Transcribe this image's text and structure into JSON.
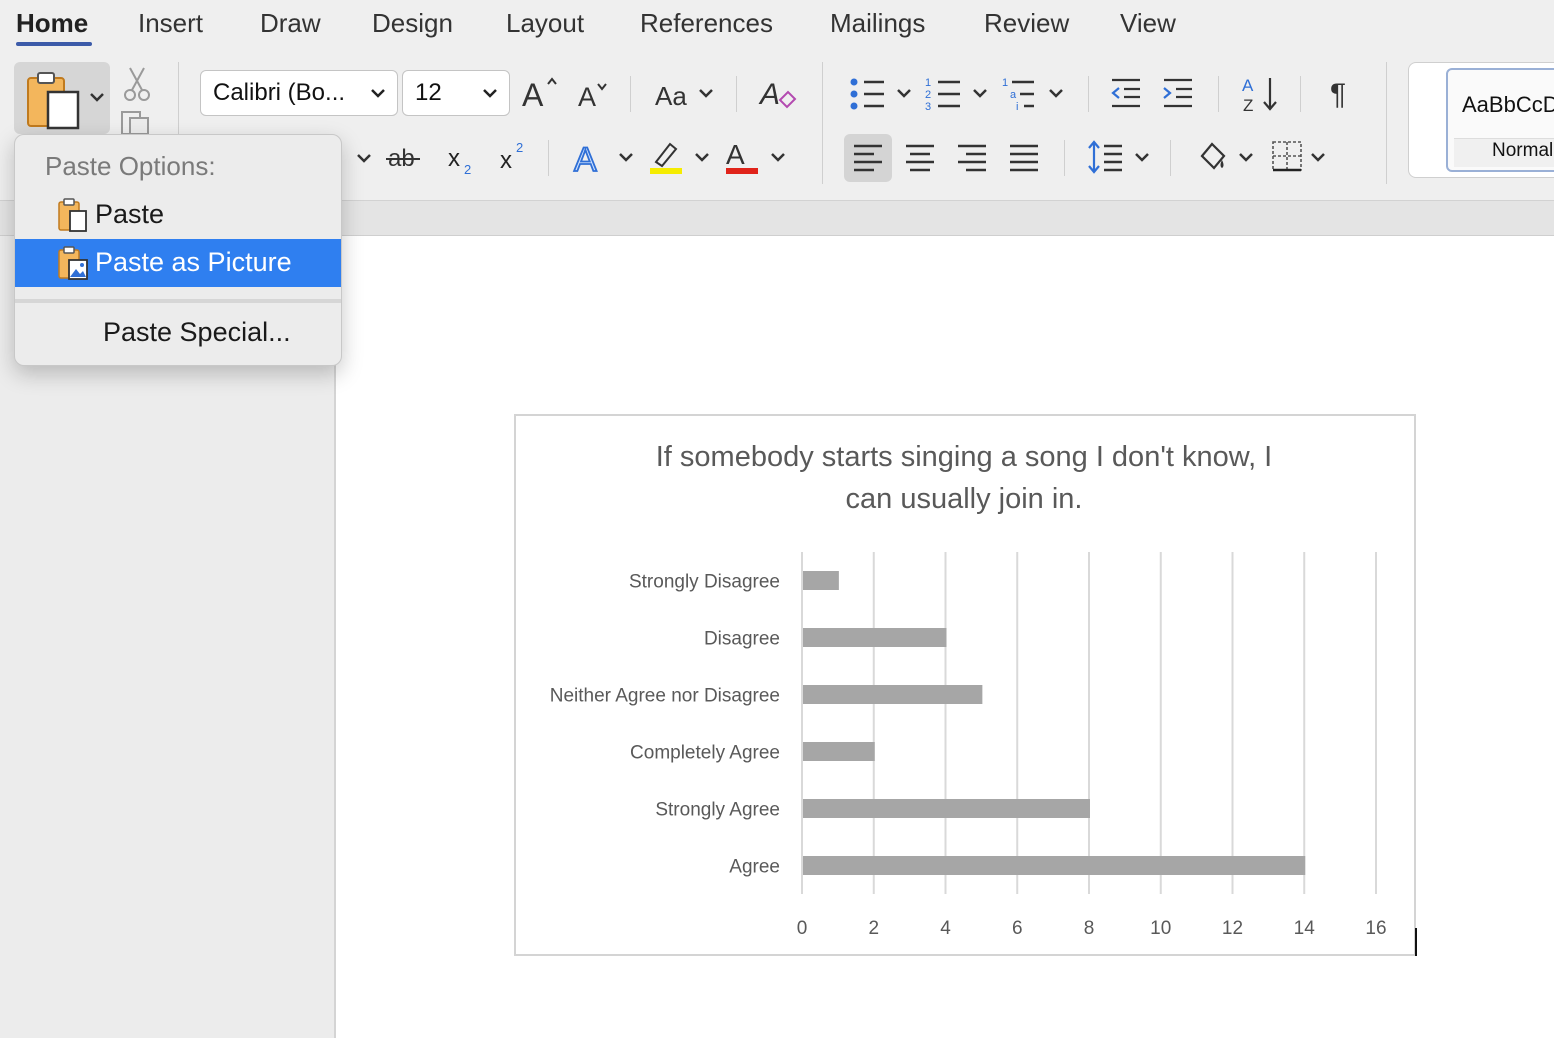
{
  "tabs": [
    {
      "label": "Home",
      "active": true
    },
    {
      "label": "Insert"
    },
    {
      "label": "Draw"
    },
    {
      "label": "Design"
    },
    {
      "label": "Layout"
    },
    {
      "label": "References"
    },
    {
      "label": "Mailings"
    },
    {
      "label": "Review"
    },
    {
      "label": "View"
    }
  ],
  "ribbon": {
    "font_name": "Calibri (Bo...",
    "font_size": "12",
    "styles": {
      "sample": "AaBbCcDd",
      "name": "Normal"
    },
    "highlight_color": "#f5ec00",
    "font_color": "#e0231a",
    "icons": [
      "paste-icon",
      "cut-icon",
      "copy-icon",
      "grow-font-icon",
      "shrink-font-icon",
      "change-case-icon",
      "clear-formatting-icon",
      "bullets-icon",
      "numbering-icon",
      "multilevel-list-icon",
      "decrease-indent-icon",
      "increase-indent-icon",
      "sort-icon",
      "pilcrow-icon",
      "strikethrough-icon",
      "subscript-icon",
      "superscript-icon",
      "text-effects-icon",
      "highlight-icon",
      "font-color-icon",
      "align-left-icon",
      "align-center-icon",
      "align-right-icon",
      "justify-icon",
      "line-spacing-icon",
      "shading-icon",
      "borders-icon"
    ]
  },
  "paste_menu": {
    "header": "Paste Options:",
    "items": [
      {
        "label": "Paste",
        "selected": false
      },
      {
        "label": "Paste as Picture",
        "selected": true
      }
    ],
    "special": "Paste Special..."
  },
  "chart_data": {
    "type": "bar",
    "orientation": "horizontal",
    "title": "If somebody starts singing a song I don't know, I can usually join in.",
    "title_lines": [
      "If somebody starts singing a song I don't know, I",
      "can usually join in."
    ],
    "categories": [
      "Strongly Disagree",
      "Disagree",
      "Neither Agree nor Disagree",
      "Completely Agree",
      "Strongly Agree",
      "Agree"
    ],
    "values": [
      1,
      4,
      5,
      2,
      8,
      14
    ],
    "xlim": [
      0,
      16
    ],
    "xticks": [
      "0",
      "2",
      "4",
      "6",
      "8",
      "10",
      "12",
      "14",
      "16"
    ],
    "grid": true,
    "bar_color": "#a6a6a6"
  }
}
